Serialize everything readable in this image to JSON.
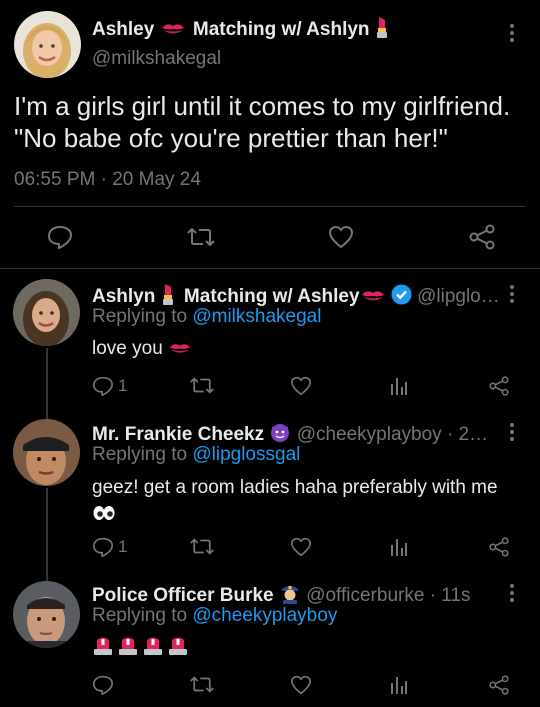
{
  "main_tweet": {
    "display_name": "Ashley",
    "display_name_suffix": "Matching w/ Ashlyn",
    "handle": "@milkshakegal",
    "text_line1": "I'm a girls girl until it comes to my girlfriend.",
    "text_line2": "\"No babe ofc you're prettier than her!\"",
    "time": "06:55 PM",
    "separator": "·",
    "date": "20 May 24"
  },
  "replies": [
    {
      "display_name": "Ashlyn",
      "display_name_suffix": "Matching w/ Ashley",
      "handle": "@lipglo…",
      "replying_prefix": "Replying to",
      "replying_to": "@milkshakegal",
      "text": "love you",
      "reply_count": "1"
    },
    {
      "display_name": "Mr. Frankie Cheekz",
      "handle": "@cheekyplayboy · 2…",
      "replying_prefix": "Replying to",
      "replying_to": "@lipglossgal",
      "text": "geez! get a room ladies haha preferably with me",
      "reply_count": "1"
    },
    {
      "display_name": "Police Officer Burke",
      "handle": "@officerburke · 11s",
      "replying_prefix": "Replying to",
      "replying_to": "@cheekyplayboy",
      "text": "",
      "reply_count": ""
    }
  ],
  "colors": {
    "background": "#000000",
    "text": "#e7e9ea",
    "muted": "#71767b",
    "link": "#1d9bf0",
    "verified": "#1d9bf0",
    "divider": "#2f3336"
  },
  "icons": [
    "reply-icon",
    "retweet-icon",
    "like-icon",
    "analytics-icon",
    "share-icon",
    "more-icon",
    "kiss-mark-icon",
    "lipstick-icon",
    "verified-icon",
    "smiling-devil-icon",
    "police-officer-icon",
    "eyes-icon",
    "police-light-icon"
  ]
}
